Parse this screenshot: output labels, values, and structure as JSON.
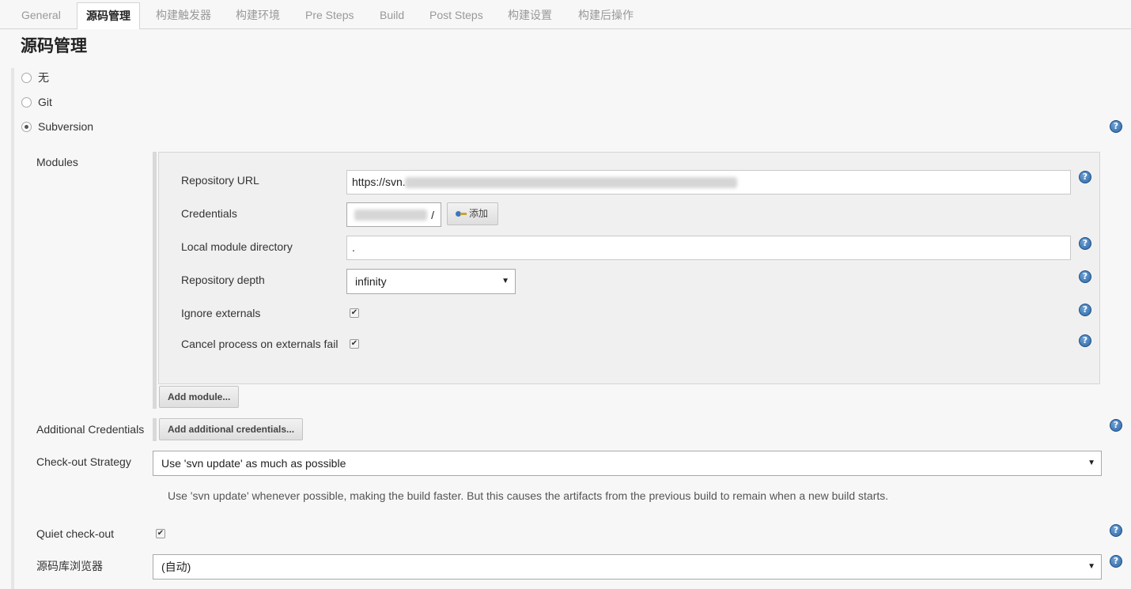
{
  "tabs": [
    {
      "label": "General",
      "active": false
    },
    {
      "label": "源码管理",
      "active": true
    },
    {
      "label": "构建触发器",
      "active": false
    },
    {
      "label": "构建环境",
      "active": false
    },
    {
      "label": "Pre Steps",
      "active": false
    },
    {
      "label": "Build",
      "active": false
    },
    {
      "label": "Post Steps",
      "active": false
    },
    {
      "label": "构建设置",
      "active": false
    },
    {
      "label": "构建后操作",
      "active": false
    }
  ],
  "section": {
    "title": "源码管理"
  },
  "scm_options": [
    {
      "label": "无",
      "selected": false
    },
    {
      "label": "Git",
      "selected": false
    },
    {
      "label": "Subversion",
      "selected": true
    }
  ],
  "modules": {
    "label": "Modules",
    "repository_url": {
      "label": "Repository URL",
      "value": "https://svn."
    },
    "credentials": {
      "label": "Credentials",
      "value": "/",
      "add_label": "添加"
    },
    "local_module_directory": {
      "label": "Local module directory",
      "value": "."
    },
    "repository_depth": {
      "label": "Repository depth",
      "value": "infinity"
    },
    "ignore_externals": {
      "label": "Ignore externals",
      "checked": true
    },
    "cancel_on_externals_fail": {
      "label": "Cancel process on externals fail",
      "checked": true
    },
    "add_module_label": "Add module..."
  },
  "additional_credentials": {
    "label": "Additional Credentials",
    "button_label": "Add additional credentials..."
  },
  "checkout_strategy": {
    "label": "Check-out Strategy",
    "value": "Use 'svn update' as much as possible",
    "description": "Use 'svn update' whenever possible, making the build faster. But this causes the artifacts from the previous build to remain when a new build starts."
  },
  "quiet_checkout": {
    "label": "Quiet check-out",
    "checked": true
  },
  "repo_browser": {
    "label": "源码库浏览器",
    "value": "(自动)"
  },
  "help_glyph": "?",
  "check_glyph": "✔",
  "caret_glyph": "▼",
  "colors": {
    "accent": "#2d67a6",
    "panel": "#f7f7f7"
  }
}
